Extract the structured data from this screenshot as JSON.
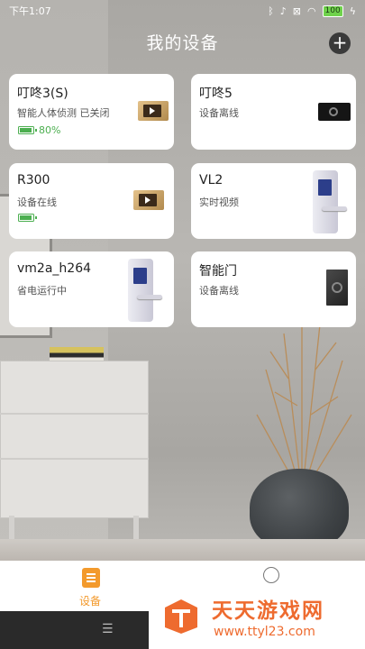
{
  "status_bar": {
    "time": "下午1:07",
    "battery": "100"
  },
  "header": {
    "title": "我的设备",
    "add_icon": "plus-icon"
  },
  "devices": [
    {
      "name": "叮咚3(S)",
      "status": "智能人体侦测 已关闭",
      "battery": "80%",
      "image": "doorbell-gold"
    },
    {
      "name": "叮咚5",
      "status": "设备离线",
      "image": "doorbell-black"
    },
    {
      "name": "R300",
      "status": "设备在线",
      "battery": "",
      "image": "doorbell-gold"
    },
    {
      "name": "VL2",
      "status": "实时视频",
      "image": "smart-lock"
    },
    {
      "name": "vm2a_h264",
      "status": "省电运行中",
      "image": "smart-lock"
    },
    {
      "name": "智能门",
      "status": "设备离线",
      "image": "smart-gate"
    }
  ],
  "bottom_nav": {
    "devices_label": "设备",
    "active_color": "#f39a2c"
  },
  "watermark": {
    "title": "天天游戏网",
    "url": "www.ttyl23.com"
  }
}
